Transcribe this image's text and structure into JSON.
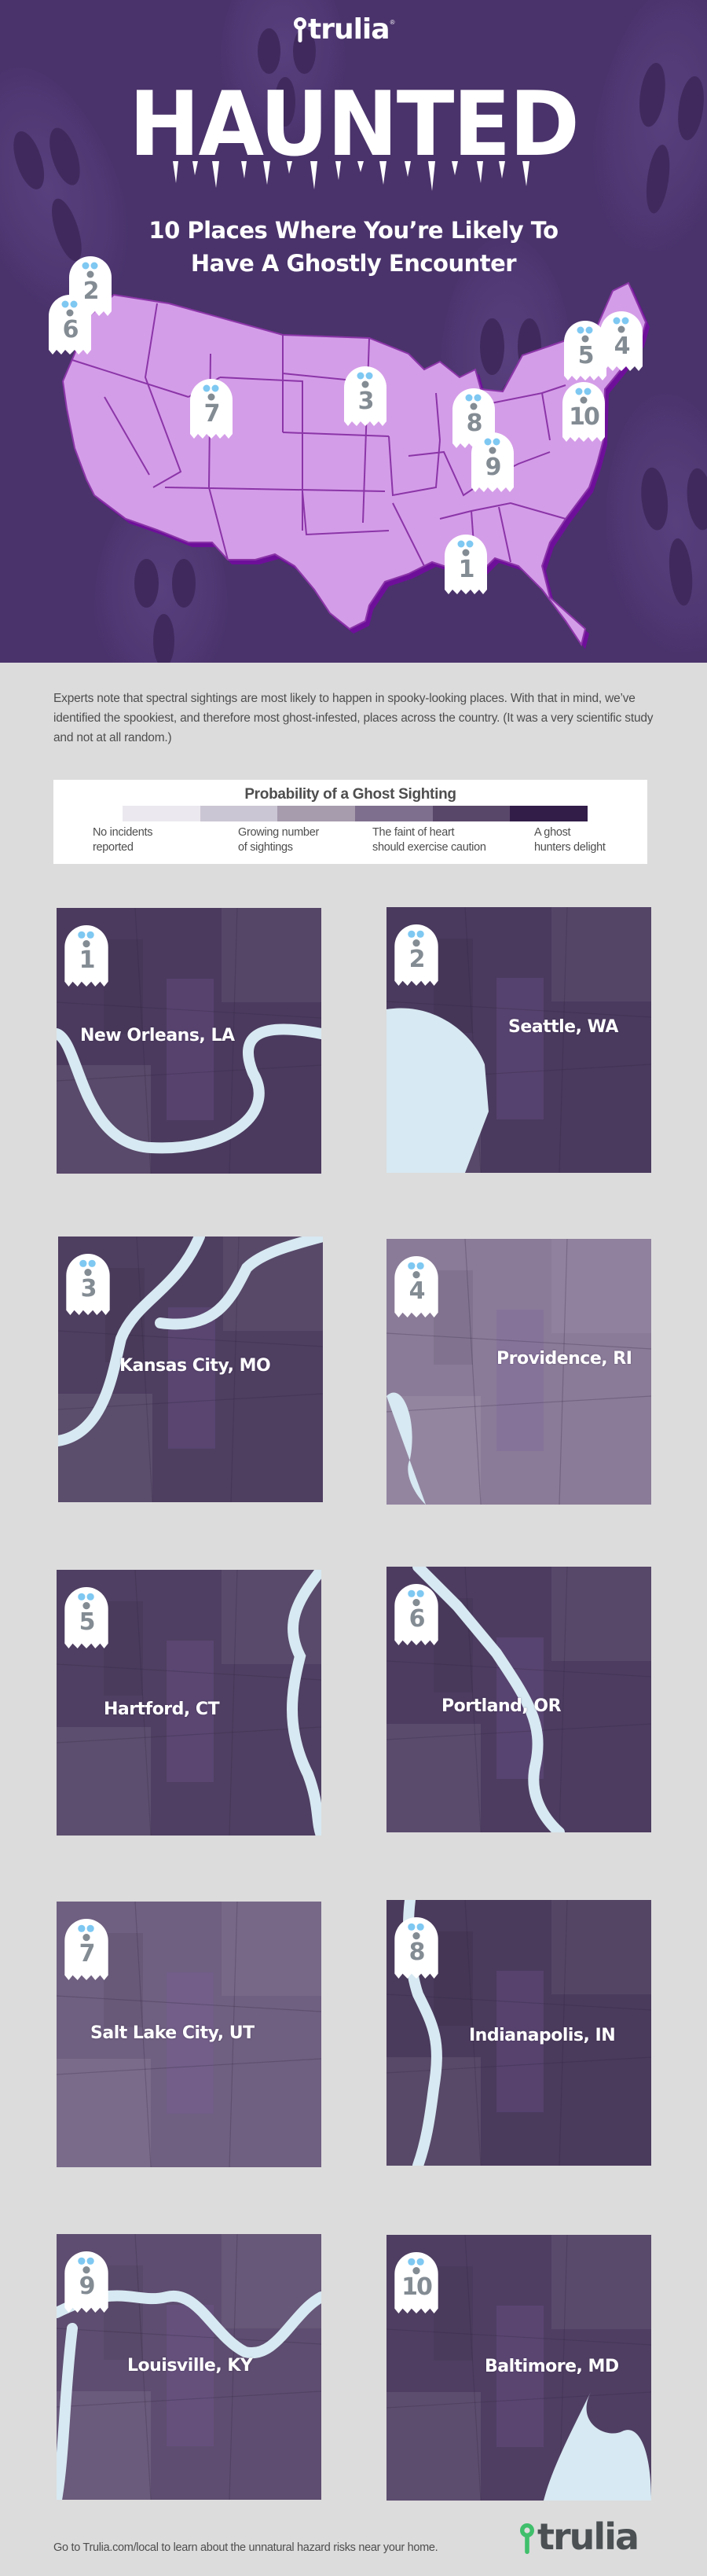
{
  "header": {
    "brand": "trulia",
    "brand_mark": "®",
    "title": "HAUNTED",
    "subtitle_lines": [
      "10 Places Where You’re Likely To",
      "Have A Ghostly Encounter"
    ]
  },
  "colors": {
    "hero_bg": "#4a336b",
    "page_bg": "#dcdcdc",
    "us_map_fill": "#d49de8",
    "us_map_border": "#8b35a8",
    "us_map_shadow": "#6e0f9a",
    "ghost_eyes": "#7ec8f2",
    "ghost_number": "#838b93",
    "water": "#d7e9f2",
    "trulia_green": "#3fbf6b"
  },
  "us_map_markers": [
    {
      "rank": "1",
      "city": "New Orleans, LA"
    },
    {
      "rank": "2",
      "city": "Seattle, WA"
    },
    {
      "rank": "3",
      "city": "Kansas City, MO"
    },
    {
      "rank": "4",
      "city": "Providence, RI"
    },
    {
      "rank": "5",
      "city": "Hartford, CT"
    },
    {
      "rank": "6",
      "city": "Portland, OR"
    },
    {
      "rank": "7",
      "city": "Salt Lake City, UT"
    },
    {
      "rank": "8",
      "city": "Indianapolis, IN"
    },
    {
      "rank": "9",
      "city": "Louisville, KY"
    },
    {
      "rank": "10",
      "city": "Baltimore, MD"
    }
  ],
  "intro": {
    "text": "Experts note that spectral sightings are most likely to happen in spooky-looking places. With that in mind, we’ve identified the spookiest, and therefore most ghost-infested, places across the country. (It was a very scientific study and not at all random.)"
  },
  "legend": {
    "title": "Probability of a Ghost Sighting",
    "swatches": [
      "#ebe8ef",
      "#cbc6d3",
      "#a69cae",
      "#7f6f8e",
      "#594769",
      "#321d48"
    ],
    "labels": [
      {
        "line1": "No incidents",
        "line2": "reported"
      },
      {
        "line1": "Growing number",
        "line2": "of sightings"
      },
      {
        "line1": "The faint of heart",
        "line2": "should exercise caution"
      },
      {
        "line1": "A ghost",
        "line2": "hunters delight"
      }
    ]
  },
  "cities": [
    {
      "rank": "1",
      "name": "New Orleans, LA",
      "tint": "#4b3a5e"
    },
    {
      "rank": "2",
      "name": "Seattle, WA",
      "tint": "#4a3a5e"
    },
    {
      "rank": "3",
      "name": "Kansas City, MO",
      "tint": "#4e3e60"
    },
    {
      "rank": "4",
      "name": "Providence, RI",
      "tint": "#8a7b98"
    },
    {
      "rank": "5",
      "name": "Hartford, CT",
      "tint": "#4f3f62"
    },
    {
      "rank": "6",
      "name": "Portland, OR",
      "tint": "#4d3c60"
    },
    {
      "rank": "7",
      "name": "Salt Lake City, UT",
      "tint": "#6f5f80"
    },
    {
      "rank": "8",
      "name": "Indianapolis, IN",
      "tint": "#4a3a5c"
    },
    {
      "rank": "9",
      "name": "Louisville, KY",
      "tint": "#5e4d70"
    },
    {
      "rank": "10",
      "name": "Baltimore, MD",
      "tint": "#4f3e62"
    }
  ],
  "footer": {
    "text": "Go to Trulia.com/local to learn about the unnatural hazard risks near your home.",
    "brand": "trulia"
  }
}
